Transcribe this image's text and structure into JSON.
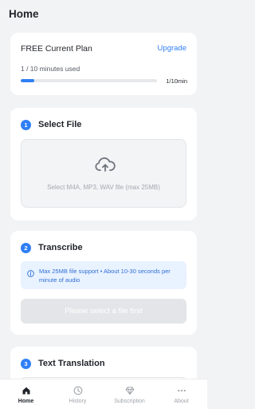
{
  "header": {
    "title": "Home"
  },
  "plan": {
    "title": "FREE Current Plan",
    "upgrade_label": "Upgrade",
    "used_text": "1 / 10 minutes used",
    "usage_fraction": 0.1,
    "progress_label": "1/10min"
  },
  "select_file": {
    "step_number": "1",
    "title": "Select File",
    "dropzone_hint": "Select M4A, MP3, WAV file (max 25MB)"
  },
  "transcribe": {
    "step_number": "2",
    "title": "Transcribe",
    "info_text": "Max 25MB file support • About 10-30 seconds per minute of audio",
    "button_label": "Please select a file first"
  },
  "translation": {
    "step_number": "3",
    "title": "Text Translation"
  },
  "nav": {
    "items": [
      {
        "label": "Home",
        "icon": "home-icon",
        "active": true
      },
      {
        "label": "History",
        "icon": "clock-icon",
        "active": false
      },
      {
        "label": "Subscription",
        "icon": "diamond-icon",
        "active": false
      },
      {
        "label": "About",
        "icon": "more-icon",
        "active": false
      }
    ]
  },
  "colors": {
    "accent": "#2f7ff6",
    "background": "#f2f3f5",
    "info_bg": "#e9f2ff",
    "disabled_button": "#e3e5e8"
  }
}
